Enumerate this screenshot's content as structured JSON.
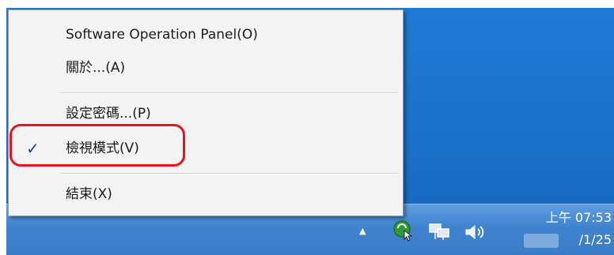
{
  "context_menu": {
    "items": [
      {
        "label": "Software Operation Panel(O)"
      },
      {
        "label": "關於...(A)"
      },
      {
        "label": "設定密碼...(P)"
      },
      {
        "label": "檢視模式(V)",
        "checked": true,
        "check_glyph": "✓"
      },
      {
        "label": "結束(X)"
      }
    ],
    "highlight_color": "#e8141c"
  },
  "taskbar": {
    "tray_expand_glyph": "▲",
    "tray_icons": [
      "scanner-app-icon",
      "network-icon",
      "volume-icon"
    ],
    "clock": {
      "time": "上午 07:53",
      "date": "/1/25"
    }
  }
}
